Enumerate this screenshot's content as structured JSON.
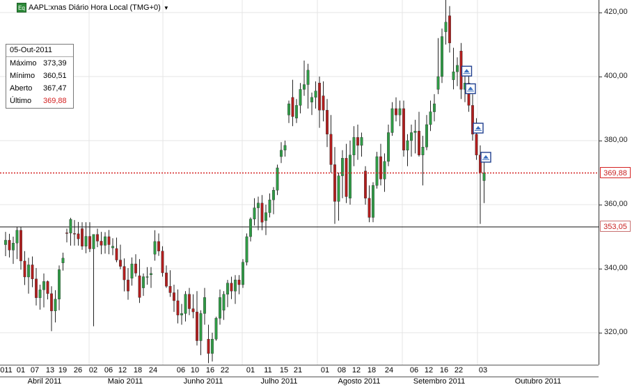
{
  "header": {
    "badge": "Eq",
    "title": "AAPL:xnas Diário Hora Local (TMG+0)",
    "menu_icon": "caret-down-icon"
  },
  "info_box": {
    "date": "05-Out-2011",
    "rows": [
      {
        "label": "Máximo",
        "value": "373,39",
        "highlight": false
      },
      {
        "label": "Mínimo",
        "value": "360,51",
        "highlight": false
      },
      {
        "label": "Aberto",
        "value": "367,47",
        "highlight": false
      },
      {
        "label": "Último",
        "value": "369,88",
        "highlight": true
      }
    ]
  },
  "price_tags": {
    "last": "369,88",
    "reference": "353,05"
  },
  "colors": {
    "up": "#2f9a45",
    "down": "#b01e1e",
    "last_line": "#d42020",
    "reference_line": "#111111",
    "grid": "#e4e4e4",
    "marker_border": "#1f3f8f"
  },
  "event_marker_icon": "triangle-up-event-icon",
  "chart_data": {
    "type": "candlestick",
    "title": "AAPL:xnas Diário Hora Local (TMG+0)",
    "y_ticks": [
      "320,00",
      "340,00",
      "360,00",
      "380,00",
      "400,00",
      "420,00"
    ],
    "ylim": [
      310,
      424
    ],
    "last_price": 369.88,
    "reference_price": 353.05,
    "grid": true,
    "x_days": [
      "011",
      "01",
      "07",
      "13",
      "19",
      "26",
      "02",
      "06",
      "12",
      "18",
      "24",
      "06",
      "10",
      "16",
      "22",
      "01",
      "11",
      "15",
      "21",
      "01",
      "08",
      "12",
      "18",
      "24",
      "06",
      "12",
      "16",
      "22",
      "03"
    ],
    "x_months": [
      "Abril 2011",
      "Maio 2011",
      "Junho 2011",
      "Julho 2011",
      "Agosto 2011",
      "Setembro 2011",
      "Outubro 2011"
    ],
    "candles": [
      [
        347.5,
        351.5,
        343.9,
        348.9
      ],
      [
        348.9,
        350.9,
        343.5,
        345.8
      ],
      [
        345.8,
        350.0,
        341.5,
        348.0
      ],
      [
        348.0,
        353.0,
        343.0,
        352.0
      ],
      [
        352.0,
        353.0,
        339.7,
        342.4
      ],
      [
        342.4,
        345.5,
        334.9,
        337.4
      ],
      [
        337.4,
        343.4,
        332.2,
        341.2
      ],
      [
        341.2,
        343.8,
        334.2,
        336.8
      ],
      [
        336.8,
        340.2,
        328.5,
        330.9
      ],
      [
        330.9,
        335.0,
        327.2,
        333.4
      ],
      [
        333.4,
        338.5,
        327.9,
        336.0
      ],
      [
        336.0,
        336.3,
        330.4,
        332.2
      ],
      [
        332.2,
        334.5,
        320.5,
        326.8
      ],
      [
        326.8,
        333.3,
        323.2,
        330.5
      ],
      [
        330.5,
        341.0,
        327.0,
        339.7
      ],
      [
        341.8,
        345.0,
        339.4,
        343.3
      ],
      [
        351.2,
        352.5,
        348.2,
        351.1
      ],
      [
        351.1,
        355.9,
        347.2,
        355.4
      ],
      [
        351.0,
        355.2,
        347.2,
        350.9
      ],
      [
        350.9,
        354.6,
        347.2,
        349.3
      ],
      [
        352.5,
        354.5,
        345.9,
        347.0
      ],
      [
        347.0,
        354.5,
        344.8,
        350.1
      ],
      [
        350.1,
        354.5,
        345.2,
        346.2
      ],
      [
        346.2,
        350.0,
        322.0,
        350.7
      ],
      [
        350.7,
        352.5,
        346.7,
        348.6
      ],
      [
        348.6,
        351.5,
        344.5,
        347.3
      ],
      [
        347.3,
        351.4,
        344.7,
        350.0
      ],
      [
        350.0,
        352.1,
        344.5,
        347.5
      ],
      [
        346.5,
        349.5,
        344.2,
        347.0
      ],
      [
        346.3,
        349.7,
        342.0,
        342.7
      ],
      [
        342.7,
        347.5,
        339.8,
        340.7
      ],
      [
        340.7,
        343.2,
        332.9,
        336.5
      ],
      [
        336.5,
        340.2,
        330.3,
        333.0
      ],
      [
        337.0,
        343.5,
        334.7,
        341.5
      ],
      [
        341.5,
        344.5,
        337.5,
        338.6
      ],
      [
        337.8,
        343.0,
        329.3,
        331.0
      ],
      [
        334.0,
        338.5,
        331.5,
        337.5
      ],
      [
        337.5,
        340.5,
        335.0,
        337.5
      ],
      [
        338.1,
        340.5,
        334.0,
        338.5
      ],
      [
        344.5,
        352.0,
        342.5,
        348.5
      ],
      [
        348.5,
        351.0,
        344.0,
        345.5
      ],
      [
        345.5,
        347.0,
        337.5,
        338.7
      ],
      [
        338.7,
        341.0,
        334.0,
        334.5
      ],
      [
        334.5,
        339.5,
        331.2,
        332.5
      ],
      [
        332.5,
        335.0,
        326.5,
        330.0
      ],
      [
        330.0,
        333.5,
        322.9,
        325.5
      ],
      [
        325.5,
        329.0,
        322.5,
        326.0
      ],
      [
        326.0,
        333.0,
        323.5,
        332.0
      ],
      [
        332.0,
        334.0,
        325.5,
        327.5
      ],
      [
        327.5,
        332.0,
        324.5,
        326.5
      ],
      [
        326.5,
        333.0,
        316.0,
        317.5
      ],
      [
        317.5,
        327.0,
        313.0,
        326.0
      ],
      [
        326.0,
        334.0,
        322.5,
        331.0
      ],
      [
        318.0,
        322.5,
        310.5,
        313.5
      ],
      [
        313.5,
        320.0,
        311.0,
        318.0
      ],
      [
        318.0,
        325.0,
        317.5,
        324.5
      ],
      [
        324.5,
        333.5,
        322.5,
        331.0
      ],
      [
        327.0,
        333.0,
        324.0,
        332.0
      ],
      [
        332.0,
        336.5,
        328.0,
        335.5
      ],
      [
        335.5,
        337.5,
        330.5,
        333.0
      ],
      [
        333.0,
        338.0,
        329.0,
        336.5
      ],
      [
        336.5,
        338.0,
        332.0,
        335.0
      ],
      [
        335.0,
        343.0,
        334.0,
        342.0
      ],
      [
        342.0,
        351.0,
        341.0,
        350.0
      ],
      [
        350.0,
        356.0,
        348.5,
        355.5
      ],
      [
        355.5,
        362.0,
        353.5,
        359.0
      ],
      [
        359.0,
        362.5,
        352.0,
        360.5
      ],
      [
        360.5,
        363.0,
        352.0,
        354.5
      ],
      [
        355.0,
        360.0,
        350.5,
        357.5
      ],
      [
        357.5,
        363.5,
        356.0,
        361.5
      ],
      [
        361.5,
        365.5,
        357.0,
        364.5
      ],
      [
        364.5,
        372.5,
        363.0,
        371.5
      ],
      [
        375.0,
        379.5,
        373.0,
        377.0
      ],
      [
        377.0,
        380.0,
        375.0,
        378.5
      ],
      [
        388.0,
        392.5,
        385.5,
        391.5
      ],
      [
        393.5,
        399.0,
        384.5,
        387.5
      ],
      [
        387.0,
        393.0,
        385.5,
        391.0
      ],
      [
        391.0,
        398.0,
        388.5,
        396.0
      ],
      [
        396.0,
        405.0,
        394.0,
        397.5
      ],
      [
        397.5,
        404.0,
        390.0,
        402.0
      ],
      [
        392.0,
        395.0,
        388.0,
        393.5
      ],
      [
        393.5,
        398.5,
        390.0,
        395.5
      ],
      [
        398.0,
        400.0,
        384.0,
        389.5
      ],
      [
        394.0,
        398.5,
        386.0,
        389.5
      ],
      [
        389.5,
        393.0,
        378.0,
        382.0
      ],
      [
        382.0,
        388.0,
        370.0,
        372.5
      ],
      [
        372.5,
        378.0,
        354.0,
        361.0
      ],
      [
        361.0,
        370.0,
        355.0,
        369.0
      ],
      [
        369.0,
        377.0,
        362.0,
        374.5
      ],
      [
        374.5,
        379.0,
        360.5,
        362.5
      ],
      [
        362.0,
        380.0,
        360.0,
        375.5
      ],
      [
        375.5,
        384.5,
        372.0,
        381.0
      ],
      [
        381.0,
        385.0,
        374.0,
        378.5
      ],
      [
        378.5,
        382.5,
        375.0,
        381.0
      ],
      [
        370.5,
        372.0,
        360.0,
        362.0
      ],
      [
        362.0,
        366.0,
        354.5,
        356.0
      ],
      [
        356.0,
        367.0,
        354.5,
        366.0
      ],
      [
        366.0,
        376.5,
        365.0,
        375.0
      ],
      [
        375.0,
        379.0,
        366.0,
        368.0
      ],
      [
        368.0,
        376.0,
        364.0,
        373.5
      ],
      [
        373.5,
        385.0,
        372.0,
        382.5
      ],
      [
        382.5,
        392.0,
        381.5,
        390.0
      ],
      [
        390.0,
        393.5,
        386.0,
        388.0
      ],
      [
        388.0,
        392.5,
        384.5,
        390.0
      ],
      [
        390.0,
        392.5,
        375.0,
        377.0
      ],
      [
        377.0,
        382.0,
        372.0,
        380.0
      ],
      [
        380.0,
        385.0,
        375.0,
        382.5
      ],
      [
        382.5,
        386.5,
        376.0,
        383.0
      ],
      [
        383.0,
        389.0,
        375.0,
        375.5
      ],
      [
        375.5,
        381.5,
        366.0,
        378.0
      ],
      [
        378.0,
        388.0,
        377.0,
        385.0
      ],
      [
        385.0,
        392.5,
        383.0,
        389.0
      ],
      [
        389.0,
        394.5,
        386.0,
        391.5
      ],
      [
        396.0,
        412.0,
        394.5,
        400.0
      ],
      [
        400.0,
        415.0,
        398.0,
        412.5
      ],
      [
        414.0,
        424.0,
        410.0,
        417.0
      ],
      [
        419.0,
        422.0,
        407.5,
        410.5
      ],
      [
        399.0,
        409.0,
        396.0,
        401.5
      ],
      [
        401.5,
        406.0,
        397.0,
        403.5
      ],
      [
        408.0,
        410.5,
        393.0,
        396.0
      ],
      [
        396.0,
        401.5,
        392.0,
        398.0
      ],
      [
        398.0,
        402.0,
        389.0,
        391.0
      ],
      [
        391.0,
        394.5,
        380.0,
        382.0
      ],
      [
        382.0,
        387.0,
        374.0,
        375.5
      ],
      [
        375.5,
        378.5,
        354.0,
        370.0
      ],
      [
        367.5,
        373.4,
        360.5,
        369.9
      ]
    ],
    "event_markers": [
      {
        "date_index": 119,
        "price": 401.7
      },
      {
        "date_index": 120,
        "price": 396.2
      },
      {
        "date_index": 122,
        "price": 383.9
      },
      {
        "date_index": 124,
        "price": 374.8
      }
    ]
  }
}
